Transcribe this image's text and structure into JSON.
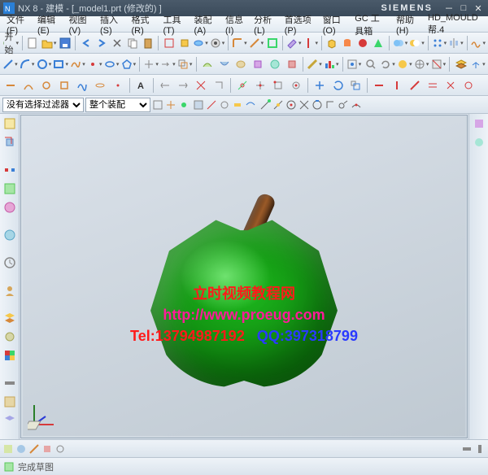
{
  "title": "NX 8 - 建模 - [_model1.prt (修改的) ]",
  "brand": "SIEMENS",
  "menus": [
    "文件(F)",
    "编辑(E)",
    "视图(V)",
    "插入(S)",
    "格式(R)",
    "工具(T)",
    "装配(A)",
    "信息(I)",
    "分析(L)",
    "首选项(P)",
    "窗口(O)",
    "GC 工具箱",
    "帮助(H)",
    "HD_MOULD 帮.4"
  ],
  "start_label": "开始",
  "filter": {
    "label1": "没有选择过滤器",
    "label2": "整个装配"
  },
  "watermark": {
    "line1": "立时视频教程网",
    "line2": "http://www.proeug.com",
    "line3a": "Tel:13794987192",
    "line3b": "QQ:397318799"
  },
  "status": {
    "text": "完成草图"
  },
  "colors": {
    "accent": "#2a7fd6",
    "apple": "#1db61d",
    "stem": "#7a4820"
  }
}
